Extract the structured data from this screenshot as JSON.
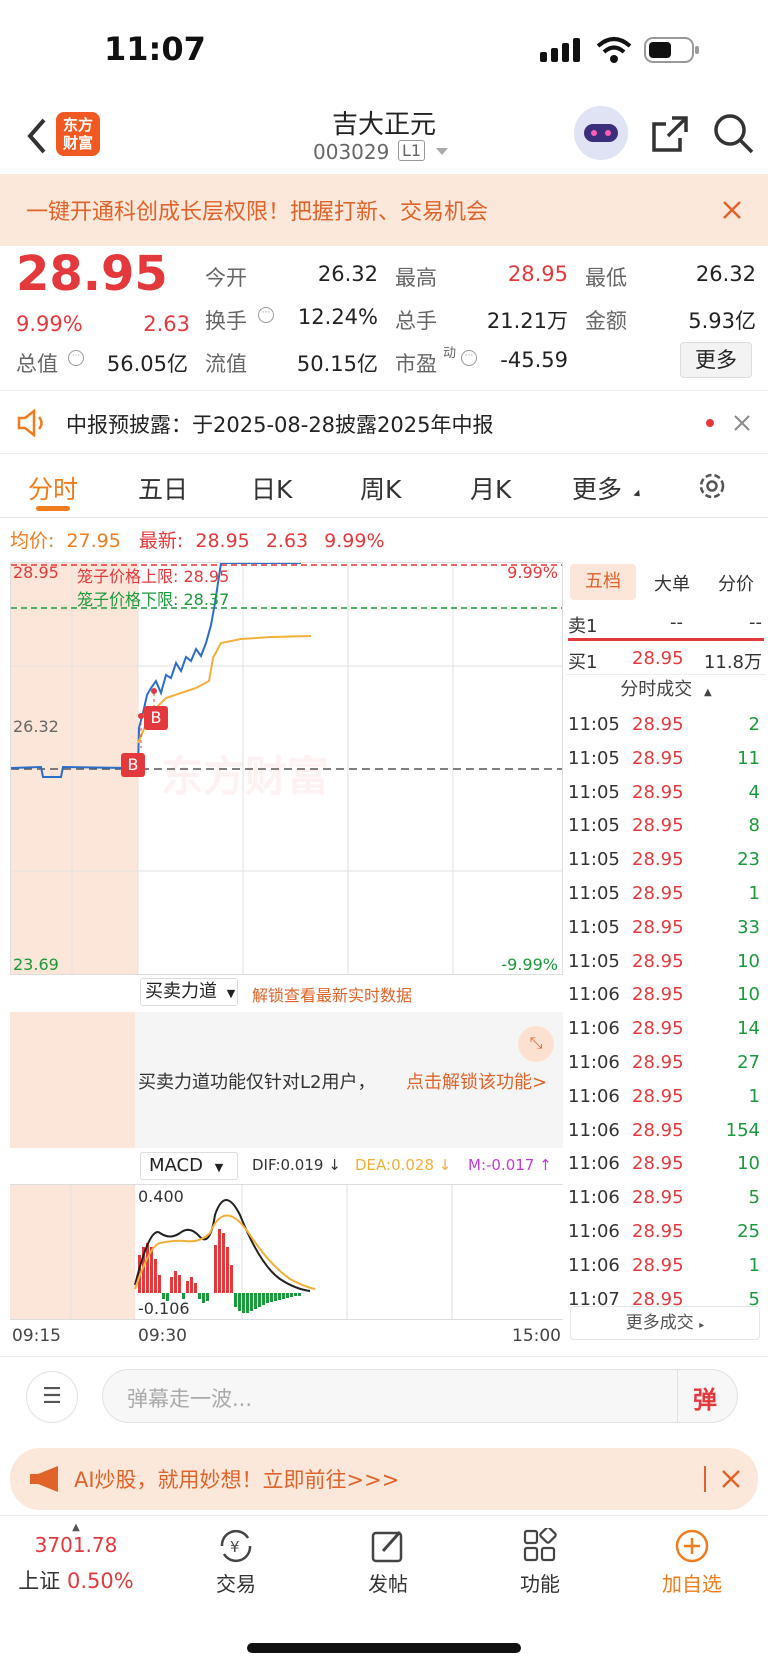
{
  "status_bar": {
    "time": "11:07"
  },
  "nav": {
    "logo_text_1": "东方",
    "logo_text_2": "财富",
    "stock_name": "吉大正元",
    "stock_code": "003029",
    "level": "L1"
  },
  "promo_banner": {
    "text": "一键开通科创成长层权限！把握打新、交易机会"
  },
  "quote": {
    "price": "28.95",
    "change_pct": "9.99%",
    "change": "2.63",
    "open_label": "今开",
    "open": "26.32",
    "high_label": "最高",
    "high": "28.95",
    "low_label": "最低",
    "low": "26.32",
    "turnover_label": "换手",
    "turnover": "12.24%",
    "volume_label": "总手",
    "volume": "21.21万",
    "amount_label": "金额",
    "amount": "5.93亿",
    "market_cap_label": "总值",
    "market_cap": "56.05亿",
    "float_cap_label": "流值",
    "float_cap": "50.15亿",
    "pe_label": "市盈",
    "pe_sup": "动",
    "pe": "-45.59",
    "more_button": "更多"
  },
  "notice": {
    "text": "中报预披露：于2025-08-28披露2025年中报"
  },
  "tabs": [
    "分时",
    "五日",
    "日K",
    "周K",
    "月K",
    "更多"
  ],
  "avg_bar": {
    "avg_label": "均价:",
    "avg": "27.95",
    "latest_label": "最新:",
    "latest": "28.95",
    "change": "2.63",
    "change_pct": "9.99%"
  },
  "chart": {
    "top_price": "28.95",
    "top_pct": "9.99%",
    "upper_limit_label": "笼子价格上限: 28.95",
    "lower_limit_label": "笼子价格下限: 28.37",
    "base_price": "26.32",
    "bottom_price": "23.69",
    "bottom_pct": "-9.99%",
    "watermark": "东方财富",
    "marker": "B"
  },
  "force": {
    "title": "买卖力道",
    "unlock_link": "解锁查看最新实时数据",
    "message": "买卖力道功能仅针对L2用户，",
    "message_link": "点击解锁该功能>"
  },
  "macd": {
    "title": "MACD",
    "dif": "DIF:0.019 ↓",
    "dea": "DEA:0.028 ↓",
    "m": "M:-0.017 ↑",
    "top": "0.400",
    "bottom": "-0.106"
  },
  "time_axis": {
    "start": "09:15",
    "mid": "09:30",
    "end": "15:00"
  },
  "side_tabs": [
    "五档",
    "大单",
    "分价"
  ],
  "order_book": {
    "sell1_label": "卖1",
    "sell1_price": "--",
    "sell1_vol": "--",
    "buy1_label": "买1",
    "buy1_price": "28.95",
    "buy1_vol": "11.8万"
  },
  "ticks_title": "分时成交",
  "ticks": [
    {
      "t": "11:05",
      "p": "28.95",
      "v": "2"
    },
    {
      "t": "11:05",
      "p": "28.95",
      "v": "11"
    },
    {
      "t": "11:05",
      "p": "28.95",
      "v": "4"
    },
    {
      "t": "11:05",
      "p": "28.95",
      "v": "8"
    },
    {
      "t": "11:05",
      "p": "28.95",
      "v": "23"
    },
    {
      "t": "11:05",
      "p": "28.95",
      "v": "1"
    },
    {
      "t": "11:05",
      "p": "28.95",
      "v": "33"
    },
    {
      "t": "11:05",
      "p": "28.95",
      "v": "10"
    },
    {
      "t": "11:06",
      "p": "28.95",
      "v": "10"
    },
    {
      "t": "11:06",
      "p": "28.95",
      "v": "14"
    },
    {
      "t": "11:06",
      "p": "28.95",
      "v": "27"
    },
    {
      "t": "11:06",
      "p": "28.95",
      "v": "1"
    },
    {
      "t": "11:06",
      "p": "28.95",
      "v": "154"
    },
    {
      "t": "11:06",
      "p": "28.95",
      "v": "10"
    },
    {
      "t": "11:06",
      "p": "28.95",
      "v": "5"
    },
    {
      "t": "11:06",
      "p": "28.95",
      "v": "25"
    },
    {
      "t": "11:06",
      "p": "28.95",
      "v": "1"
    },
    {
      "t": "11:07",
      "p": "28.95",
      "v": "5"
    }
  ],
  "more_ticks": "更多成交",
  "comment": {
    "placeholder": "弹幕走一波...",
    "danmu_btn": "弹"
  },
  "ai_banner": {
    "text": "AI炒股，就用妙想！立即前往>>>"
  },
  "bottom": {
    "index_value": "3701.78",
    "index_name": "上证",
    "index_pct": "0.50%",
    "trade": "交易",
    "post": "发帖",
    "function": "功能",
    "add": "加自选"
  }
}
